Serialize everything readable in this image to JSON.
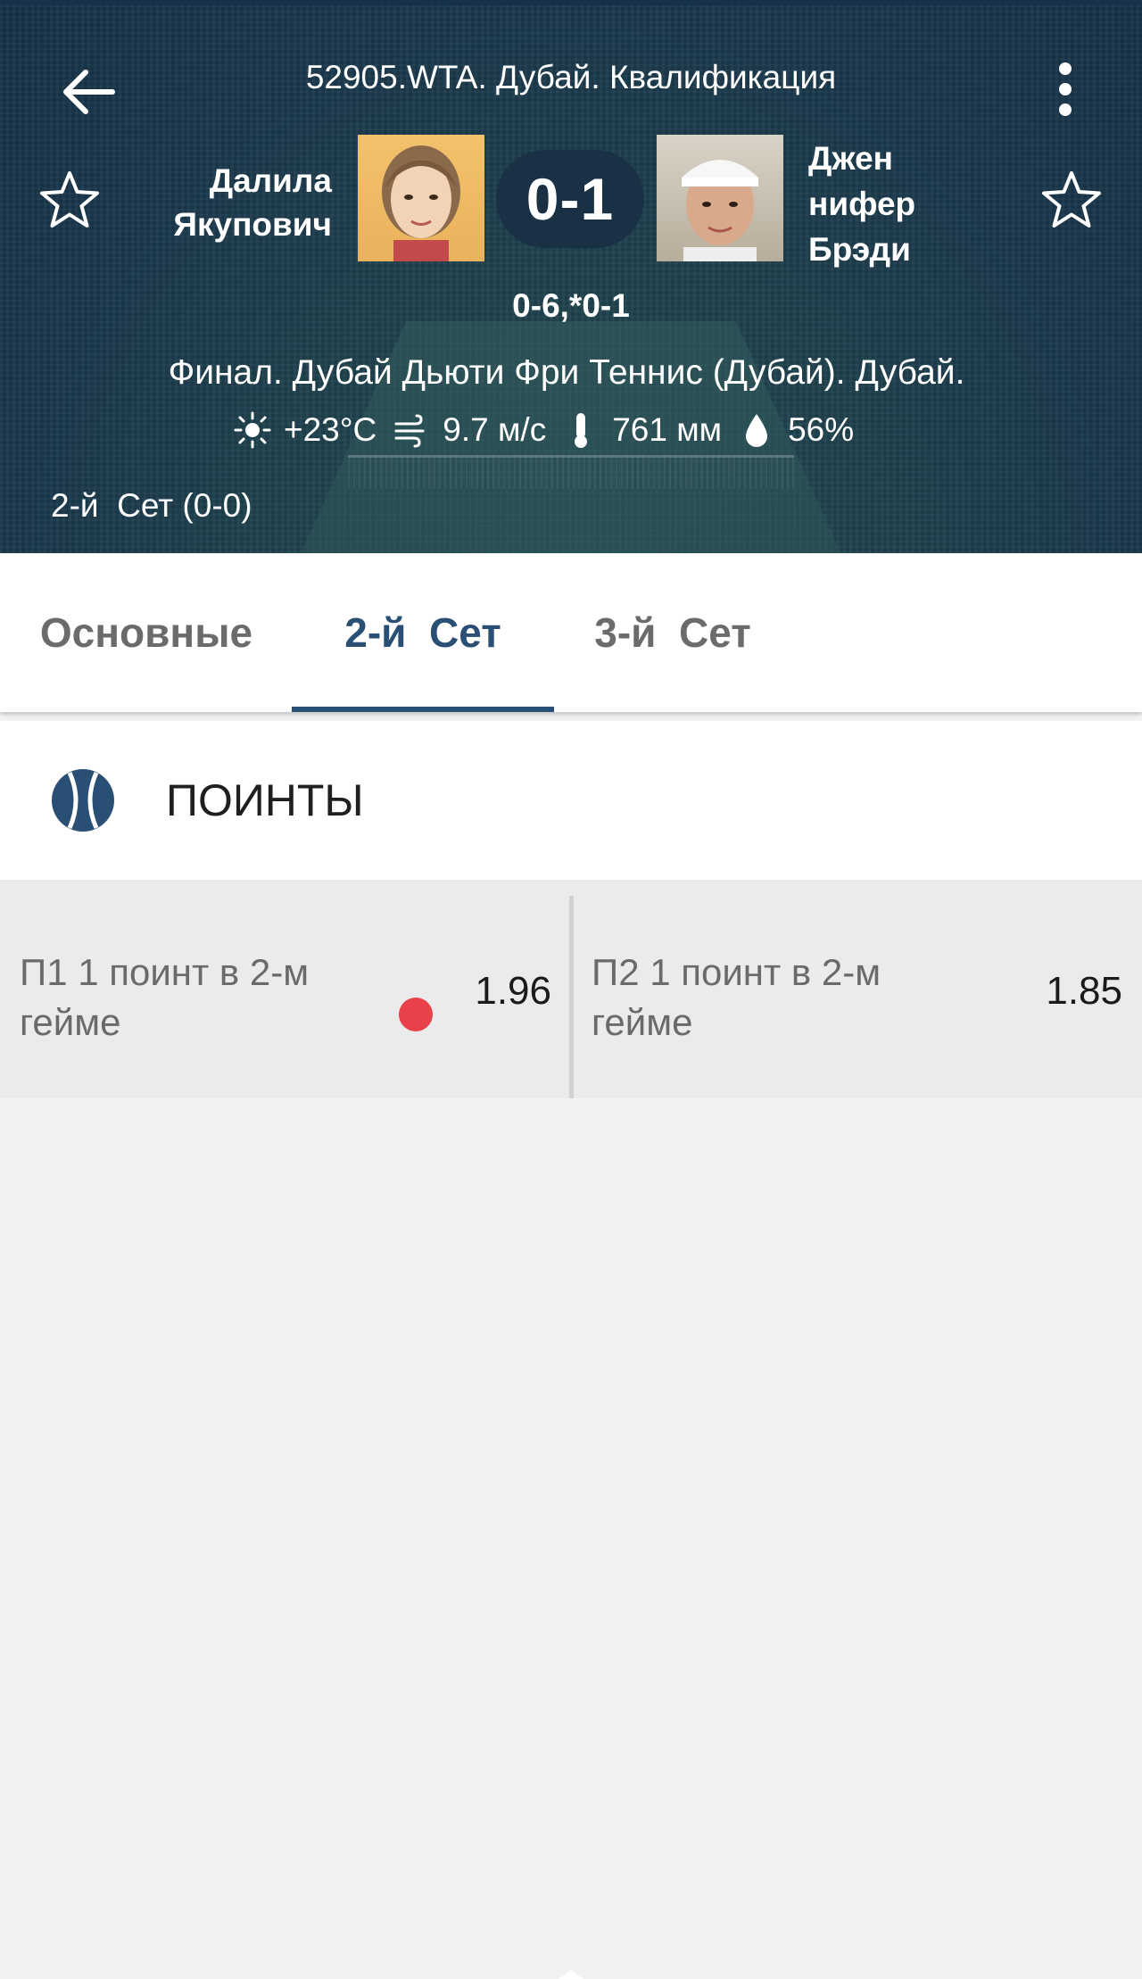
{
  "header": {
    "title": "52905.WTA. Дубай. Квалификация",
    "player1": {
      "first": "Далила",
      "last": "Якупович"
    },
    "player2": {
      "line1": "Джен",
      "line2": "нифер",
      "line3": "Брэди"
    },
    "score": "0-1",
    "sets_score": "0-6,*0-1",
    "tournament": "Финал. Дубай Дьюти Фри Теннис (Дубай). Дубай.",
    "weather": {
      "temperature": "+23°C",
      "wind": "9.7 м/с",
      "pressure": "761 мм",
      "humidity": "56%"
    },
    "set_status": "2-й  Сет (0-0)"
  },
  "tabs": [
    {
      "label": "Основные"
    },
    {
      "label": "2-й  Сет",
      "active": true
    },
    {
      "label": "3-й  Сет"
    }
  ],
  "section": {
    "title": "ПОИНТЫ"
  },
  "bets": [
    {
      "label": "П1 1 поинт в 2-м гейме",
      "odds": "1.96",
      "live": true
    },
    {
      "label": "П2 1 поинт в 2-м гейме",
      "odds": "1.85",
      "live": false
    }
  ],
  "colors": {
    "accent": "#2a4f75",
    "live_dot": "#e8414a",
    "header_overlay": "#1c3348"
  }
}
